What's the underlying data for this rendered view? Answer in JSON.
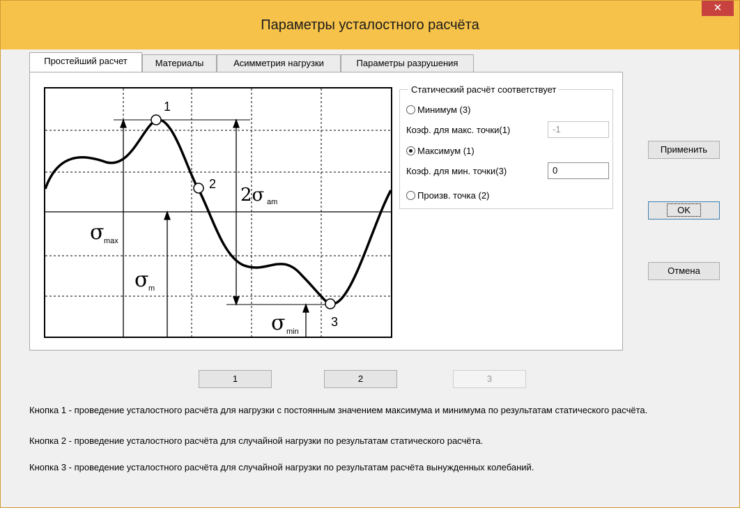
{
  "window": {
    "title": "Параметры усталостного расчёта",
    "close_glyph": "✕"
  },
  "tabs": [
    {
      "label": "Простейший расчет",
      "active": true
    },
    {
      "label": "Материалы",
      "active": false
    },
    {
      "label": "Асимметрия нагрузки",
      "active": false
    },
    {
      "label": "Параметры разрушения",
      "active": false
    }
  ],
  "diagram": {
    "point1": "1",
    "point2": "2",
    "point3": "3",
    "label_2sigma": "2σ",
    "sub_am": "am",
    "label_sigma_max": "σ",
    "sub_max": "max",
    "label_sigma_m": "σ",
    "sub_m": "m",
    "label_sigma_min": "σ",
    "sub_min": "min"
  },
  "static_group": {
    "title": "Статический расчёт соответствует",
    "options": [
      {
        "label": "Минимум (3)",
        "checked": false
      },
      {
        "label": "Максимум (1)",
        "checked": true
      },
      {
        "label": "Произв. точка (2)",
        "checked": false
      }
    ],
    "coef_max_label": "Коэф. для макс. точки(1)",
    "coef_max_value": "-1",
    "coef_min_label": "Коэф. для мин. точки(3)",
    "coef_min_value": "0"
  },
  "buttons": {
    "apply": "Применить",
    "ok": "OK",
    "cancel": "Отмена",
    "b1": "1",
    "b2": "2",
    "b3": "3"
  },
  "descriptions": {
    "d1": "Кнопка 1 - проведение усталостного расчёта для нагрузки с постоянным значением максимума и минимума по результатам статического расчёта.",
    "d2": "Кнопка 2 - проведение усталостного расчёта для случайной нагрузки по результатам статического расчёта.",
    "d3": "Кнопка 3 - проведение усталостного расчёта для случайной нагрузки по результатам расчёта вынужденных колебаний."
  },
  "colors": {
    "titlebar": "#f6c24a",
    "close": "#c7423e",
    "focus": "#3c7fb1"
  }
}
